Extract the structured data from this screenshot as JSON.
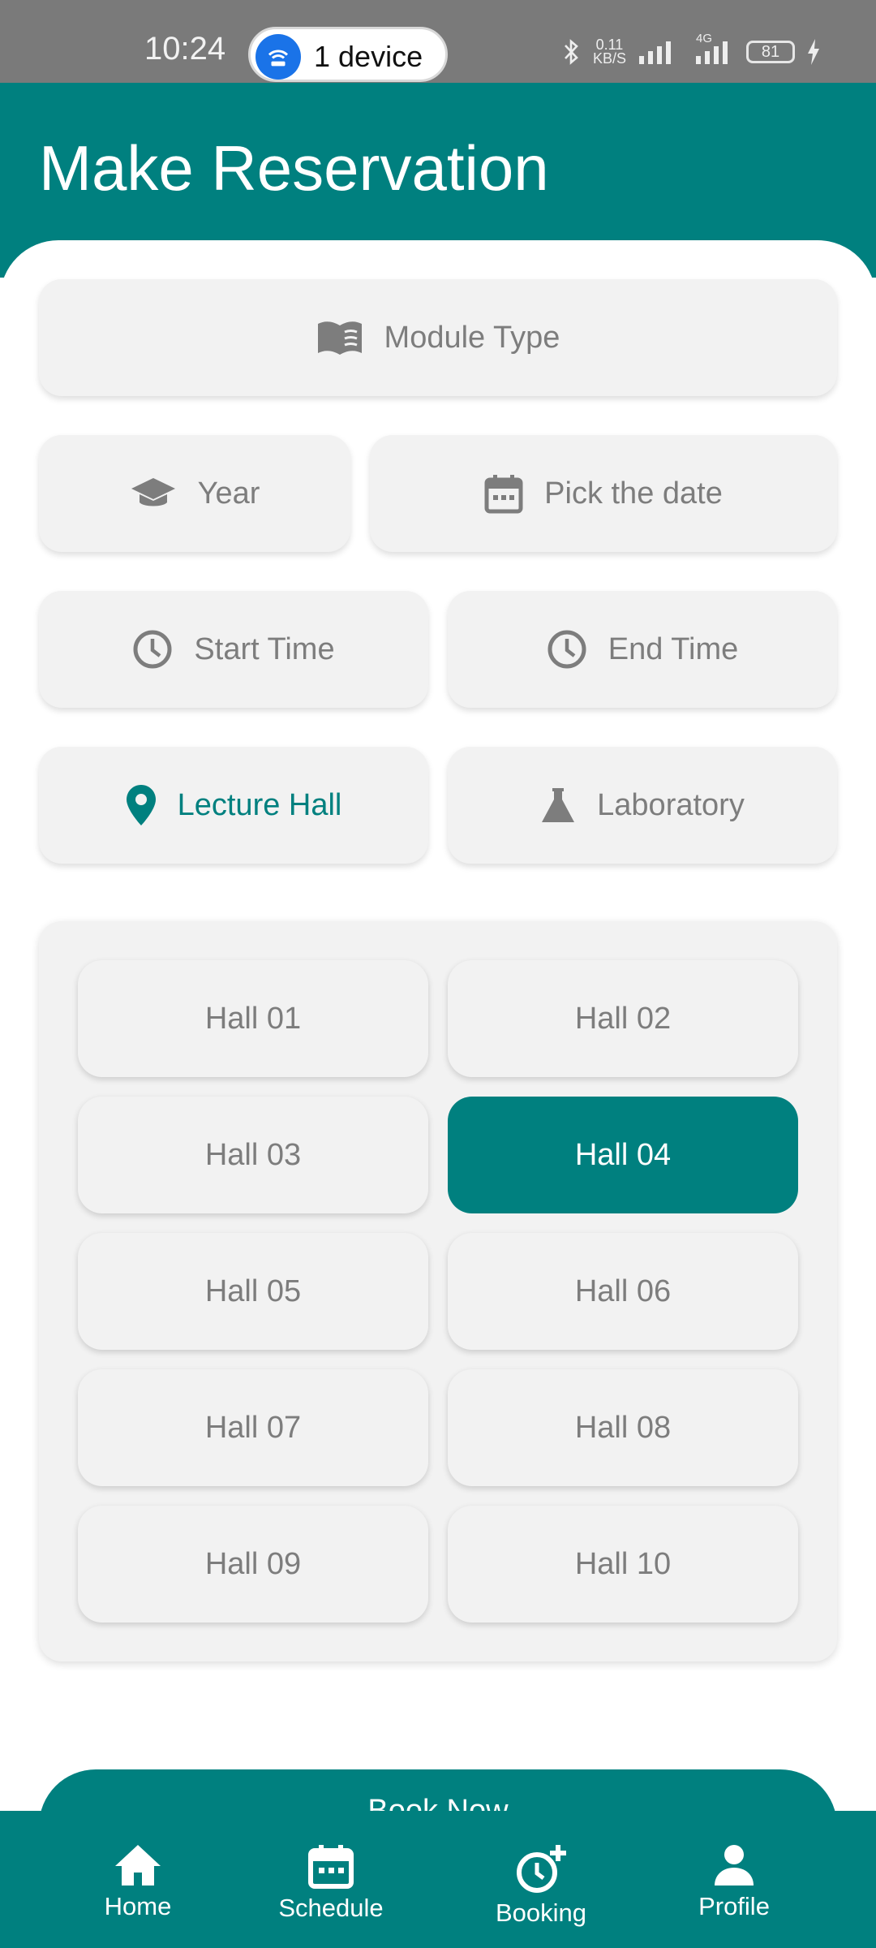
{
  "status_bar": {
    "time": "10:24",
    "hotspot_label": "1 device",
    "net_speed_value": "0.11",
    "net_speed_unit": "KB/S",
    "network_type": "4G",
    "battery": "81"
  },
  "header": {
    "title": "Make Reservation"
  },
  "form": {
    "module_type": "Module Type",
    "year": "Year",
    "pick_date": "Pick the date",
    "start_time": "Start Time",
    "end_time": "End Time",
    "lecture_hall": "Lecture Hall",
    "laboratory": "Laboratory"
  },
  "halls": {
    "items": [
      "Hall 01",
      "Hall 02",
      "Hall 03",
      "Hall 04",
      "Hall 05",
      "Hall 06",
      "Hall 07",
      "Hall 08",
      "Hall 09",
      "Hall 10"
    ],
    "selected": "Hall 04"
  },
  "book_button": "Book Now",
  "nav": {
    "home": "Home",
    "schedule": "Schedule",
    "booking": "Booking",
    "profile": "Profile"
  },
  "colors": {
    "accent": "#00807f",
    "field_bg": "#f2f2f2",
    "text_muted": "#7d7d7d",
    "status_bar": "#7a7a7a"
  },
  "icons": {
    "module_type": "book-open-icon",
    "year": "graduation-cap-icon",
    "date": "calendar-icon",
    "time": "clock-icon",
    "lecture_hall": "location-pin-icon",
    "laboratory": "flask-icon"
  }
}
